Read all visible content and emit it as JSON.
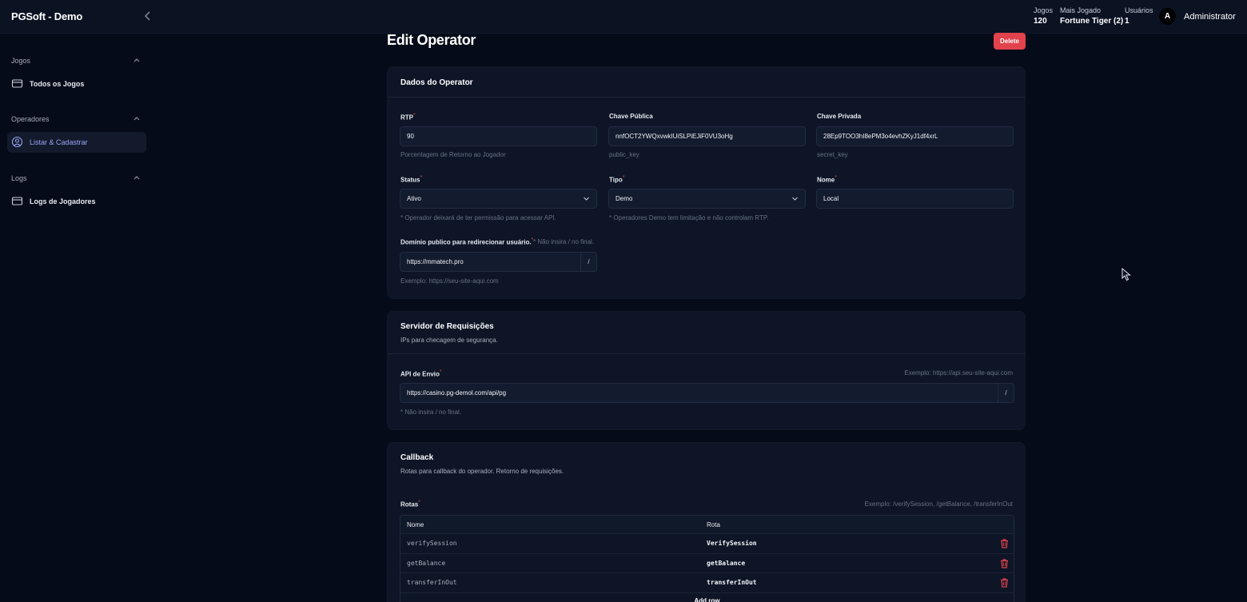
{
  "app": {
    "title": "PGSoft - Demo"
  },
  "header": {
    "stats": [
      {
        "label": "Jogos",
        "value": "120"
      },
      {
        "label": "Mais Jogado",
        "value": "Fortune Tiger (2)"
      },
      {
        "label": "Usuários",
        "value": "1"
      }
    ],
    "avatar_initial": "A",
    "user_name": "Administrator"
  },
  "sidebar": {
    "sections": [
      {
        "title": "Jogos",
        "items": [
          {
            "label": "Todos os Jogos",
            "icon": "folder-icon"
          }
        ]
      },
      {
        "title": "Operadores",
        "items": [
          {
            "label": "Listar & Cadastrar",
            "icon": "user-circle-icon",
            "active": true
          }
        ]
      },
      {
        "title": "Logs",
        "items": [
          {
            "label": "Logs de Jogadores",
            "icon": "folder-icon"
          }
        ]
      }
    ]
  },
  "page": {
    "title": "Edit Operator",
    "delete_label": "Delete"
  },
  "operator_card": {
    "title": "Dados do Operator",
    "rtp": {
      "label": "RTP",
      "value": "90",
      "hint": "Porcentagem de Retorno ao Jogador"
    },
    "public_key": {
      "label": "Chave Pública",
      "value": "nnfOCT2YWQxvwkIUiSLPiEJiF0VU3oHg",
      "hint": "public_key"
    },
    "private_key": {
      "label": "Chave Privada",
      "value": "28Ep9TOO3hI8ePM3o4evhZKyJ1df4xrL",
      "hint": "secret_key"
    },
    "status": {
      "label": "Status",
      "value": "Ativo",
      "hint": "* Operador deixará de ter permissão para acessar API."
    },
    "tipo": {
      "label": "Tipo",
      "value": "Demo",
      "hint": "* Operadores Demo tem limitação e não controlam RTP."
    },
    "nome": {
      "label": "Nome",
      "value": "Local"
    },
    "dominio": {
      "label": "Domínio publico para redirecionar usuário.",
      "note": "* Não insira / no final.",
      "value": "https://mmatech.pro",
      "suffix": "/",
      "hint": "Exemplo: https://seu-site-aqui.com"
    }
  },
  "server_card": {
    "title": "Servidor de Requisições",
    "subtitle": "IPs para checagem de segurança.",
    "api": {
      "label": "API de Envio",
      "example": "Exemplo: https://api.seu-site-aqui.com",
      "value": "https://casino.pg-demol.com/api/pg",
      "suffix": "/",
      "hint": "* Não insira / no final."
    }
  },
  "callback_card": {
    "title": "Callback",
    "subtitle": "Rotas para callback do operador. Retorno de requisições.",
    "routes_label": "Rotas",
    "routes_example": "Exemplo: /verifySession, /getBalance, /transferInOut",
    "columns": [
      "Nome",
      "Rota"
    ],
    "rows": [
      {
        "nome": "verifySession",
        "rota": "VerifySession"
      },
      {
        "nome": "getBalance",
        "rota": "getBalance"
      },
      {
        "nome": "transferInOut",
        "rota": "transferInOut"
      }
    ],
    "add_row_label": "Add row"
  },
  "colors": {
    "accent": "#9aa6f6",
    "danger": "#e2424c",
    "background": "#050b18",
    "card": "#0d1526"
  }
}
